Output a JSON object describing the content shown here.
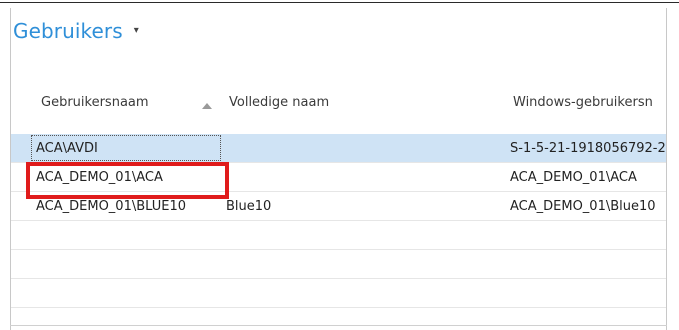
{
  "header": {
    "title": "Gebruikers"
  },
  "table": {
    "columns": [
      "Gebruikersnaam",
      "Volledige naam",
      "Windows-gebruikersn"
    ],
    "sorted_column": "Gebruikersnaam",
    "sort_direction": "ascending",
    "rows": [
      {
        "username": "ACA\\AVDI",
        "full_name": "",
        "windows_user": "S-1-5-21-1918056792-2",
        "selected": true
      },
      {
        "username": "ACA_DEMO_01\\ACA",
        "full_name": "",
        "windows_user": "ACA_DEMO_01\\ACA",
        "selected": false
      },
      {
        "username": "ACA_DEMO_01\\BLUE10",
        "full_name": "Blue10",
        "windows_user": "ACA_DEMO_01\\Blue10",
        "selected": false
      },
      {
        "username": "",
        "full_name": "",
        "windows_user": "",
        "selected": false
      },
      {
        "username": "",
        "full_name": "",
        "windows_user": "",
        "selected": false
      },
      {
        "username": "",
        "full_name": "",
        "windows_user": "",
        "selected": false
      }
    ]
  },
  "colors": {
    "title": "#2f8fd8",
    "selected_row": "#cfe3f5",
    "highlight_box": "#e01b1b"
  }
}
